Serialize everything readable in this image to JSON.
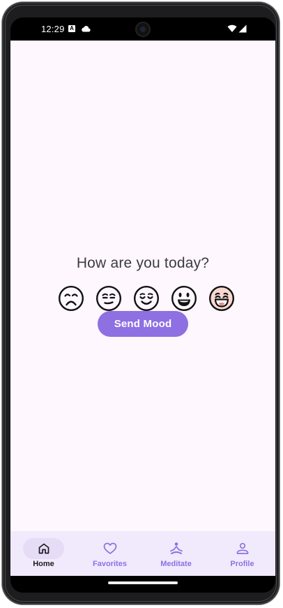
{
  "status_bar": {
    "time": "12:29",
    "notification_icons": [
      "a-notification-icon",
      "cloud-icon"
    ],
    "system_icons": [
      "wifi-icon",
      "signal-icon"
    ]
  },
  "main": {
    "question": "How are you today?",
    "moods": [
      {
        "name": "sad",
        "icon": "sad-face-icon"
      },
      {
        "name": "meh",
        "icon": "meh-face-icon"
      },
      {
        "name": "calm",
        "icon": "calm-face-icon"
      },
      {
        "name": "happy",
        "icon": "happy-face-icon"
      },
      {
        "name": "excited",
        "icon": "excited-face-icon",
        "tint": "#f7d9d0"
      }
    ],
    "send_button_label": "Send Mood"
  },
  "nav": {
    "items": [
      {
        "label": "Home",
        "icon": "home-icon",
        "active": true
      },
      {
        "label": "Favorites",
        "icon": "heart-icon",
        "active": false
      },
      {
        "label": "Meditate",
        "icon": "meditate-icon",
        "active": false
      },
      {
        "label": "Profile",
        "icon": "person-icon",
        "active": false
      }
    ]
  },
  "colors": {
    "accent": "#8e70e2",
    "background": "#fef7fe",
    "nav_background": "#f1eafc",
    "active_pill": "#e6dcf6"
  }
}
